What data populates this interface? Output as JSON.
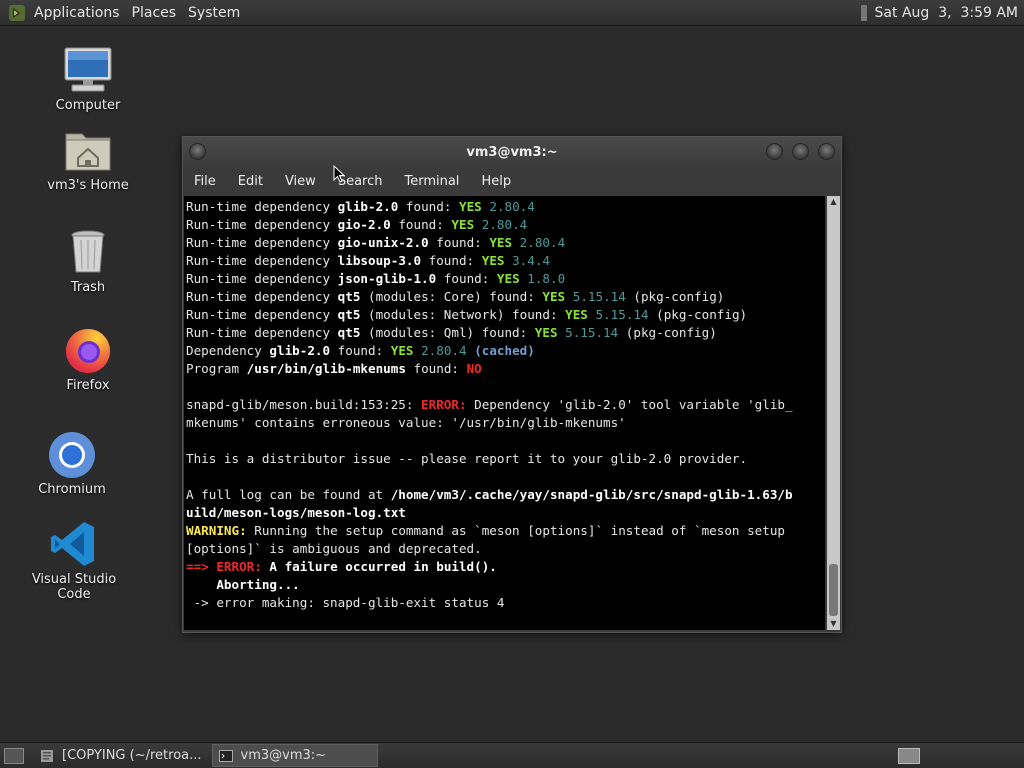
{
  "top_panel": {
    "menus": [
      "Applications",
      "Places",
      "System"
    ],
    "clock": "Sat Aug  3,  3:59 AM"
  },
  "desktop_icons": [
    {
      "label": "Computer",
      "icon": "computer-icon"
    },
    {
      "label": "vm3's Home",
      "icon": "home-folder-icon"
    },
    {
      "label": "Trash",
      "icon": "trash-icon"
    },
    {
      "label": "Firefox",
      "icon": "firefox-icon"
    },
    {
      "label": "Chromium",
      "icon": "chromium-icon"
    },
    {
      "label": "Visual Studio Code",
      "icon": "vscode-icon"
    }
  ],
  "terminal": {
    "title": "vm3@vm3:~",
    "menu": [
      "File",
      "Edit",
      "View",
      "Search",
      "Terminal",
      "Help"
    ],
    "lines": [
      [
        {
          "t": "Run-time dependency "
        },
        {
          "t": "glib-2.0",
          "c": "b"
        },
        {
          "t": " found: "
        },
        {
          "t": "YES",
          "c": "yes"
        },
        {
          "t": " "
        },
        {
          "t": "2.80.4",
          "c": "ver"
        }
      ],
      [
        {
          "t": "Run-time dependency "
        },
        {
          "t": "gio-2.0",
          "c": "b"
        },
        {
          "t": " found: "
        },
        {
          "t": "YES",
          "c": "yes"
        },
        {
          "t": " "
        },
        {
          "t": "2.80.4",
          "c": "ver"
        }
      ],
      [
        {
          "t": "Run-time dependency "
        },
        {
          "t": "gio-unix-2.0",
          "c": "b"
        },
        {
          "t": " found: "
        },
        {
          "t": "YES",
          "c": "yes"
        },
        {
          "t": " "
        },
        {
          "t": "2.80.4",
          "c": "ver"
        }
      ],
      [
        {
          "t": "Run-time dependency "
        },
        {
          "t": "libsoup-3.0",
          "c": "b"
        },
        {
          "t": " found: "
        },
        {
          "t": "YES",
          "c": "yes"
        },
        {
          "t": " "
        },
        {
          "t": "3.4.4",
          "c": "ver"
        }
      ],
      [
        {
          "t": "Run-time dependency "
        },
        {
          "t": "json-glib-1.0",
          "c": "b"
        },
        {
          "t": " found: "
        },
        {
          "t": "YES",
          "c": "yes"
        },
        {
          "t": " "
        },
        {
          "t": "1.8.0",
          "c": "ver"
        }
      ],
      [
        {
          "t": "Run-time dependency "
        },
        {
          "t": "qt5",
          "c": "b"
        },
        {
          "t": " (modules: Core) found: "
        },
        {
          "t": "YES",
          "c": "yes"
        },
        {
          "t": " "
        },
        {
          "t": "5.15.14",
          "c": "ver"
        },
        {
          "t": " (pkg-config)"
        }
      ],
      [
        {
          "t": "Run-time dependency "
        },
        {
          "t": "qt5",
          "c": "b"
        },
        {
          "t": " (modules: Network) found: "
        },
        {
          "t": "YES",
          "c": "yes"
        },
        {
          "t": " "
        },
        {
          "t": "5.15.14",
          "c": "ver"
        },
        {
          "t": " (pkg-config)"
        }
      ],
      [
        {
          "t": "Run-time dependency "
        },
        {
          "t": "qt5",
          "c": "b"
        },
        {
          "t": " (modules: Qml) found: "
        },
        {
          "t": "YES",
          "c": "yes"
        },
        {
          "t": " "
        },
        {
          "t": "5.15.14",
          "c": "ver"
        },
        {
          "t": " (pkg-config)"
        }
      ],
      [
        {
          "t": "Dependency "
        },
        {
          "t": "glib-2.0",
          "c": "b"
        },
        {
          "t": " found: "
        },
        {
          "t": "YES",
          "c": "yes"
        },
        {
          "t": " "
        },
        {
          "t": "2.80.4",
          "c": "ver"
        },
        {
          "t": " "
        },
        {
          "t": "(cached)",
          "c": "cached"
        }
      ],
      [
        {
          "t": "Program "
        },
        {
          "t": "/usr/bin/glib-mkenums",
          "c": "b"
        },
        {
          "t": " found: "
        },
        {
          "t": "NO",
          "c": "no"
        }
      ],
      [
        {
          "t": ""
        }
      ],
      [
        {
          "t": "snapd-glib/meson.build:153:25: "
        },
        {
          "t": "ERROR:",
          "c": "err"
        },
        {
          "t": " Dependency 'glib-2.0' tool variable 'glib_"
        }
      ],
      [
        {
          "t": "mkenums' contains erroneous value: '/usr/bin/glib-mkenums'"
        }
      ],
      [
        {
          "t": ""
        }
      ],
      [
        {
          "t": "This is a distributor issue -- please report it to your glib-2.0 provider."
        }
      ],
      [
        {
          "t": ""
        }
      ],
      [
        {
          "t": "A full log can be found at "
        },
        {
          "t": "/home/vm3/.cache/yay/snapd-glib/src/snapd-glib-1.63/b",
          "c": "b"
        }
      ],
      [
        {
          "t": "uild/meson-logs/meson-log.txt",
          "c": "b"
        }
      ],
      [
        {
          "t": "WARNING:",
          "c": "warn"
        },
        {
          "t": " Running the setup command as `meson [options]` instead of `meson setup"
        }
      ],
      [
        {
          "t": "[options]` is ambiguous and deprecated."
        }
      ],
      [
        {
          "t": "==> ",
          "c": "err"
        },
        {
          "t": "ERROR:",
          "c": "err"
        },
        {
          "t": " A failure occurred in build().",
          "c": "b"
        }
      ],
      [
        {
          "t": "    Aborting...",
          "c": "b"
        }
      ],
      [
        {
          "t": " -> error making: snapd-glib-exit status 4"
        }
      ]
    ]
  },
  "taskbar": {
    "tasks": [
      {
        "label": "[COPYING (~/retroa...",
        "active": false
      },
      {
        "label": "vm3@vm3:~",
        "active": true
      }
    ]
  }
}
